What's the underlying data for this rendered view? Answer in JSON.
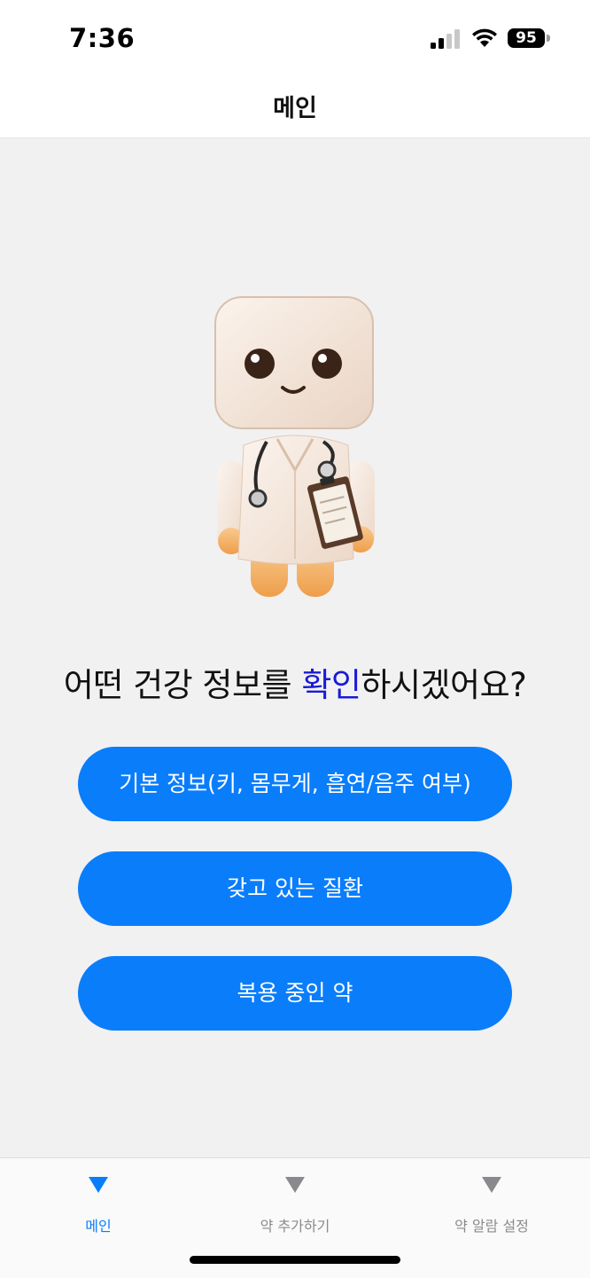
{
  "status_bar": {
    "time": "7:36",
    "battery_level": "95",
    "signal_icon": "cellular-signal-icon",
    "wifi_icon": "wifi-icon"
  },
  "nav": {
    "title": "메인"
  },
  "hero": {
    "mascot": "doctor-mascot",
    "question_before": "어떤 건강 정보를 ",
    "question_highlight": "확인",
    "question_after": "하시겠어요?"
  },
  "buttons": {
    "basic_info": "기본 정보(키, 몸무게, 흡연/음주 여부)",
    "diseases": "갖고 있는 질환",
    "medications": "복용 중인 약"
  },
  "tab_bar": {
    "items": [
      {
        "label": "메인",
        "icon": "triangle-down-icon",
        "active": true
      },
      {
        "label": "약 추가하기",
        "icon": "triangle-down-icon",
        "active": false
      },
      {
        "label": "약 알람 설정",
        "icon": "triangle-down-icon",
        "active": false
      }
    ]
  },
  "colors": {
    "accent": "#0a7dfb",
    "highlight": "#1a1ad6",
    "background": "#f1f1f2"
  }
}
